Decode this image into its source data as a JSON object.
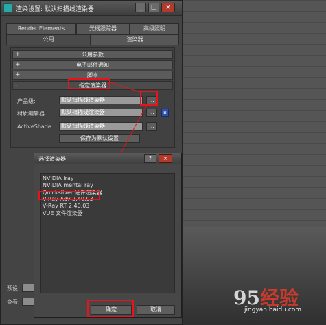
{
  "render_setup": {
    "title": "渲染设置: 默认扫描线渲染器",
    "window_buttons": [
      "_",
      "□",
      "×"
    ],
    "tabs_row1": [
      "Render Elements",
      "光线跟踪器",
      "高级照明"
    ],
    "tabs_row2": [
      "公用",
      "渲染器"
    ],
    "rollouts": [
      {
        "sign": "+",
        "label": "公用参数"
      },
      {
        "sign": "+",
        "label": "电子邮件通知"
      },
      {
        "sign": "+",
        "label": "脚本"
      },
      {
        "sign": "-",
        "label": "指定渲染器"
      }
    ],
    "assign_rows": [
      {
        "label": "产品级:",
        "value": "默认扫描线渲染器",
        "button": "..."
      },
      {
        "label": "材质编辑器:",
        "value": "默认扫描线渲染器",
        "button": "...",
        "lock": "B"
      },
      {
        "label": "ActiveShade:",
        "value": "默认扫描线渲染器",
        "button": "..."
      }
    ],
    "save_default_label": "保存为默认设置",
    "bottom_preset_label": "预设:",
    "bottom_view_label": "查看:"
  },
  "choose_renderer": {
    "title": "选择渲染器",
    "help_label": "?",
    "close_label": "×",
    "renderers": [
      "NVIDIA iray",
      "NVIDIA mental ray",
      "Quicksilver 硬件渲染器",
      "V-Ray Adv 2.40.03",
      "V-Ray RT 2.40.03",
      "VUE 文件渲染器"
    ],
    "ok_label": "确定",
    "cancel_label": "取消"
  },
  "watermark": {
    "logo_prefix": "95",
    "logo_suffix": "经验",
    "url": "jingyan.baidu.com"
  },
  "colors": {
    "highlight": "#e8131b",
    "dialog_bg": "#444444",
    "viewport_bg": "#555555"
  }
}
